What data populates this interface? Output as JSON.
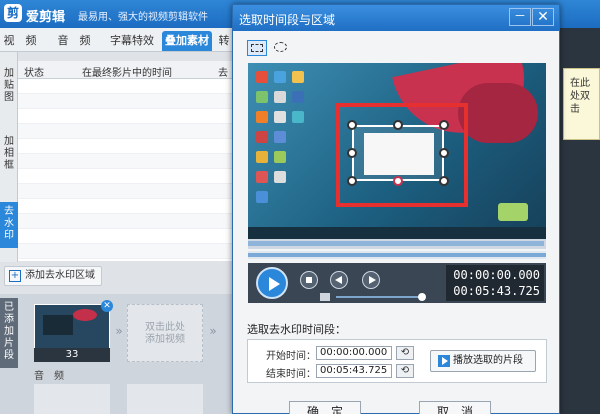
{
  "app": {
    "logo_char": "剪",
    "name": "爱剪辑",
    "slogan": "最易用、强大的视频剪辑软件"
  },
  "main_tabs": [
    {
      "label": "视　频"
    },
    {
      "label": "音　频"
    },
    {
      "label": "字幕特效"
    },
    {
      "label": "叠加素材",
      "active": true
    },
    {
      "label": "转"
    }
  ],
  "left_tabs": [
    {
      "label": "加贴图"
    },
    {
      "label": "加相框"
    },
    {
      "label": "去水印",
      "active": true
    }
  ],
  "table": {
    "headers": [
      "状态",
      "在最终影片中的时间",
      "去"
    ]
  },
  "add_watermark_label": "添加去水印区域",
  "added_clips": {
    "label": "已添加片段",
    "clip_number": "33",
    "empty_slot_text": "双击此处添加视频",
    "audio_label": "音　频"
  },
  "background_note": "在此处双击",
  "dialog": {
    "title": "选取时间段与区域",
    "minimize_icon": "－",
    "close_icon": "✕",
    "current_time": "00:00:00.000",
    "total_time": "00:05:43.725",
    "time_section_heading": "选取去水印时间段：",
    "start_label": "开始时间：",
    "start_value": "00:00:00.000",
    "end_label": "结束时间：",
    "end_value": "00:05:43.725",
    "sync_icon": "⟲",
    "play_selection_label": "播放选取的片段",
    "ok_label": "确　定",
    "cancel_label": "取　消"
  },
  "colors": {
    "accent": "#2b87d9",
    "highlight_frame": "#e5302f"
  }
}
